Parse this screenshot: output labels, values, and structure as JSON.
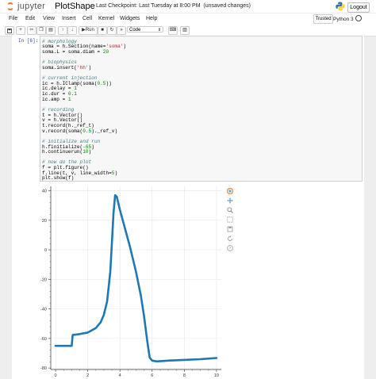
{
  "header": {
    "logo_text": "jupyter",
    "notebook_name": "PlotShape",
    "checkpoint": "Last Checkpoint: Last Tuesday at 8:00 PM",
    "unsaved": "(unsaved changes)",
    "logout": "Logout"
  },
  "menu": [
    "File",
    "Edit",
    "View",
    "Insert",
    "Cell",
    "Kernel",
    "Widgets",
    "Help"
  ],
  "status": {
    "trusted": "Trusted",
    "kernel": "Python 3"
  },
  "toolbar": {
    "run_label": "Run",
    "cell_type": "Code"
  },
  "cell": {
    "prompt": "In [6]:",
    "lines": [
      {
        "c": "# morphology",
        "t": "com"
      },
      {
        "c": "soma = h.Section(name=",
        "s": "'soma'",
        "e": ")"
      },
      {
        "c": "soma.L = soma.diam = ",
        "n": "20"
      },
      {
        "c": ""
      },
      {
        "c": "# biophysics",
        "t": "com"
      },
      {
        "c": "soma.insert(",
        "s": "'hh'",
        "e": ")"
      },
      {
        "c": ""
      },
      {
        "c": "# current injection",
        "t": "com"
      },
      {
        "c": "ic = h.IClamp(soma(",
        "n": "0.5",
        "e": "))"
      },
      {
        "c": "ic.delay = ",
        "n": "1"
      },
      {
        "c": "ic.dur = ",
        "n": "0.1"
      },
      {
        "c": "ic.amp = ",
        "n": "1"
      },
      {
        "c": ""
      },
      {
        "c": "# recording",
        "t": "com"
      },
      {
        "c": "t = h.Vector()"
      },
      {
        "c": "v = h.Vector()"
      },
      {
        "c": "t.record(h._ref_t)"
      },
      {
        "c": "v.record(soma(",
        "n": "0.5",
        "e": ")._ref_v)"
      },
      {
        "c": ""
      },
      {
        "c": "# initialize and run",
        "t": "com"
      },
      {
        "c": "h.finitialize(",
        "n": "-65",
        "e": ")"
      },
      {
        "c": "h.continuerun(",
        "n": "10",
        "e": ")"
      },
      {
        "c": ""
      },
      {
        "c": "# now do the plot",
        "t": "com"
      },
      {
        "c": "f = plt.figure()"
      },
      {
        "c": "f.line(t, v, line_width=",
        "n": "5",
        "e": ")"
      },
      {
        "c": "plt.show(f)"
      }
    ]
  },
  "colors": {
    "line": "#1f77b4",
    "comment": "#408080",
    "string": "#ba2121",
    "number": "#008800",
    "prompt": "#303f9f"
  },
  "chart_data": {
    "type": "line",
    "xlim": [
      -0.3,
      10.3
    ],
    "ylim": [
      -81,
      43
    ],
    "x_ticks": [
      0,
      2,
      4,
      6,
      8,
      10
    ],
    "y_ticks": [
      -80,
      -60,
      -40,
      -20,
      0,
      20,
      40
    ],
    "grid": true,
    "series": [
      {
        "x": [
          0,
          0.5,
          1.0,
          1.06,
          1.1,
          1.2,
          1.5,
          2.0,
          2.5,
          2.8,
          3.0,
          3.2,
          3.4,
          3.5,
          3.6,
          3.7,
          3.8,
          4.0,
          4.3,
          4.6,
          5.0,
          5.3,
          5.5,
          5.7,
          5.85,
          6.0,
          6.3,
          7.0,
          8.0,
          9.0,
          10.0
        ],
        "y": [
          -65,
          -65,
          -65,
          -57.8,
          -57.5,
          -57.5,
          -57,
          -56,
          -53,
          -49,
          -44,
          -35,
          -15,
          5,
          25,
          37,
          36,
          27,
          15,
          3,
          -15,
          -31,
          -45,
          -62,
          -73,
          -75,
          -75.5,
          -75,
          -74.5,
          -74,
          -73.2
        ]
      }
    ]
  }
}
